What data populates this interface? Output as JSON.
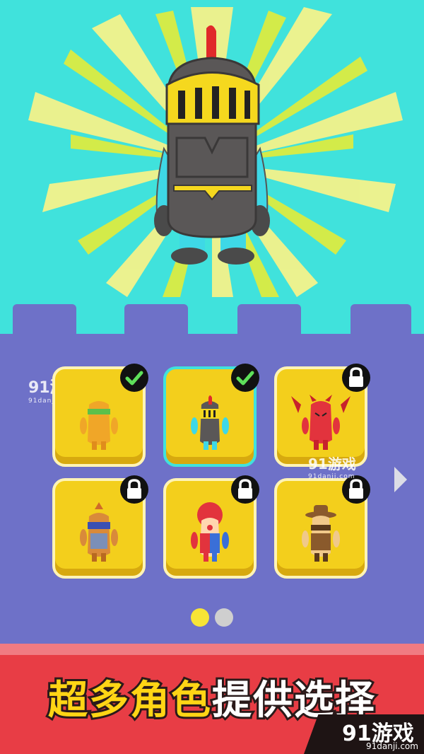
{
  "colors": {
    "sky": "#40e2dc",
    "castle": "#6e71c8",
    "slot": "#f3cf1c",
    "selected_border": "#40e2dc",
    "banner": "#e83d45",
    "caption_primary": "#ffd515",
    "caption_secondary": "#ffffff"
  },
  "hero": {
    "character_name": "knight",
    "icon": "knight-character"
  },
  "grid": {
    "slots": [
      {
        "character": "green-headband-bean",
        "status": "owned",
        "badge_icon": "check-icon",
        "selected": false
      },
      {
        "character": "knight",
        "status": "owned",
        "badge_icon": "check-icon",
        "selected": true
      },
      {
        "character": "red-devil",
        "status": "locked",
        "badge_icon": "lock-icon",
        "selected": false
      },
      {
        "character": "samurai-bean",
        "status": "locked",
        "badge_icon": "lock-icon",
        "selected": false
      },
      {
        "character": "clown",
        "status": "locked",
        "badge_icon": "lock-icon",
        "selected": false
      },
      {
        "character": "cowboy",
        "status": "locked",
        "badge_icon": "lock-icon",
        "selected": false
      }
    ],
    "next_icon": "chevron-right-icon"
  },
  "pagination": {
    "current_page": 1,
    "total_pages": 2
  },
  "banner": {
    "caption_part1": "超多角色",
    "caption_part2": "提供选择"
  },
  "watermarks": [
    {
      "text": "91游戏",
      "sub": "91danji.com"
    },
    {
      "text": "91游戏",
      "sub": "91danji.com"
    },
    {
      "text": "91游戏",
      "sub": "91danji.com"
    }
  ]
}
